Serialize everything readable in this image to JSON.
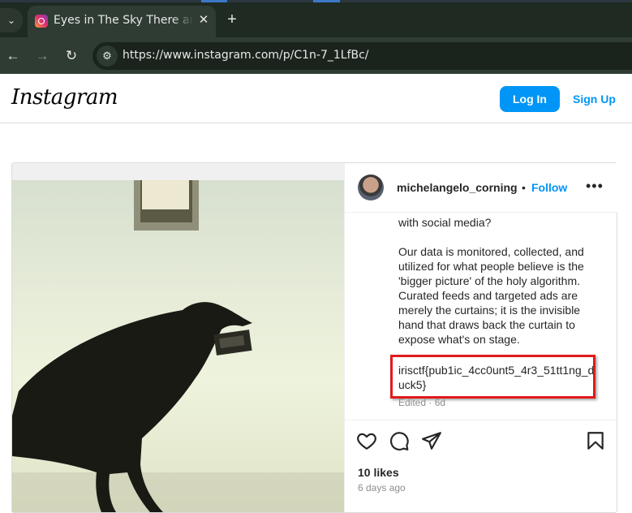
{
  "browser": {
    "tab_title": "Eyes in The Sky There are No Secrets",
    "url": "https://www.instagram.com/p/C1n-7_1LfBc/",
    "tab_close": "✕",
    "new_tab": "+",
    "tab_list": "⌄"
  },
  "header": {
    "logo": "Instagram",
    "login_label": "Log In",
    "signup_label": "Sign Up"
  },
  "post": {
    "username": "michelangelo_corning",
    "separator": "•",
    "follow_label": "Follow",
    "more": "•••",
    "caption_partial_top": "with social media?",
    "caption_paragraph": "Our data is monitored, collected, and utilized for what people believe is the 'bigger picture' of the holy algorithm. Curated feeds and targeted ads are merely the curtains; it is the invisible hand that draws back the curtain to expose what's on stage.",
    "flag": "irisctf{pub1ic_4cc0unt5_4r3_51tt1ng_duck5}",
    "edited": "Edited · 6d",
    "likes": "10 likes",
    "posted_ago": "6 days ago"
  },
  "colors": {
    "accent": "#0095f6",
    "highlight": "#e11b1b",
    "chrome": "#2f3c33"
  }
}
